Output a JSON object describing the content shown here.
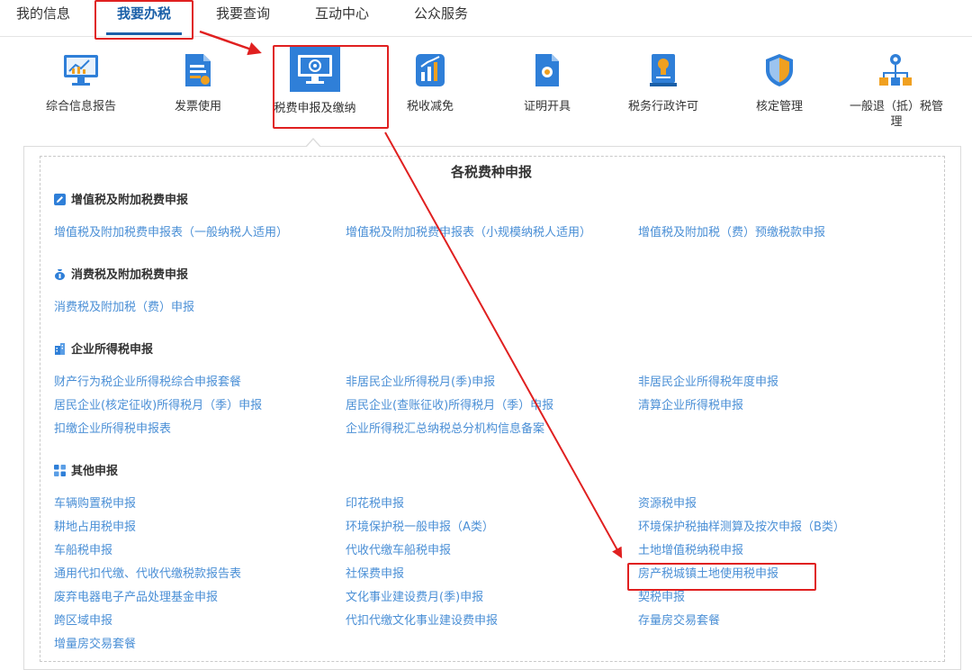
{
  "nav": {
    "tabs": [
      "我的信息",
      "我要办税",
      "我要查询",
      "互动中心",
      "公众服务"
    ],
    "active_index": 1
  },
  "functions": [
    {
      "label": "综合信息报告",
      "icon": "monitor-chart-icon"
    },
    {
      "label": "发票使用",
      "icon": "invoice-icon"
    },
    {
      "label": "税费申报及缴纳",
      "icon": "monitor-tax-icon"
    },
    {
      "label": "税收减免",
      "icon": "bar-chart-icon"
    },
    {
      "label": "证明开具",
      "icon": "certificate-icon"
    },
    {
      "label": "税务行政许可",
      "icon": "license-icon"
    },
    {
      "label": "核定管理",
      "icon": "shield-icon"
    },
    {
      "label": "一般退（抵）税管理",
      "icon": "network-icon"
    }
  ],
  "panel": {
    "title": "各税费种申报",
    "sections": [
      {
        "title": "增值税及附加税费申报",
        "icon": "edit-icon",
        "items": [
          "增值税及附加税费申报表（一般纳税人适用）",
          "增值税及附加税费申报表（小规模纳税人适用）",
          "增值税及附加税（费）预缴税款申报"
        ]
      },
      {
        "title": "消费税及附加税费申报",
        "icon": "money-bag-icon",
        "items": [
          "消费税及附加税（费）申报"
        ]
      },
      {
        "title": "企业所得税申报",
        "icon": "building-icon",
        "items": [
          "财产行为税企业所得税综合申报套餐",
          "非居民企业所得税月(季)申报",
          "非居民企业所得税年度申报",
          "居民企业(核定征收)所得税月（季）申报",
          "居民企业(查账征收)所得税月（季）申报",
          "清算企业所得税申报",
          "扣缴企业所得税申报表",
          "企业所得税汇总纳税总分机构信息备案"
        ]
      },
      {
        "title": "其他申报",
        "icon": "grid-icon",
        "items": [
          "车辆购置税申报",
          "印花税申报",
          "资源税申报",
          "耕地占用税申报",
          "环境保护税一般申报（A类）",
          "环境保护税抽样测算及按次申报（B类）",
          "车船税申报",
          "代收代缴车船税申报",
          "土地增值税纳税申报",
          "通用代扣代缴、代收代缴税款报告表",
          "社保费申报",
          "房产税城镇土地使用税申报",
          "废弃电器电子产品处理基金申报",
          "文化事业建设费月(季)申报",
          "契税申报",
          "跨区域申报",
          "代扣代缴文化事业建设费申报",
          "存量房交易套餐",
          "增量房交易套餐"
        ]
      }
    ]
  },
  "colors": {
    "accent": "#1a5fa8",
    "link": "#4a8fd6",
    "annotation": "#e02020"
  }
}
